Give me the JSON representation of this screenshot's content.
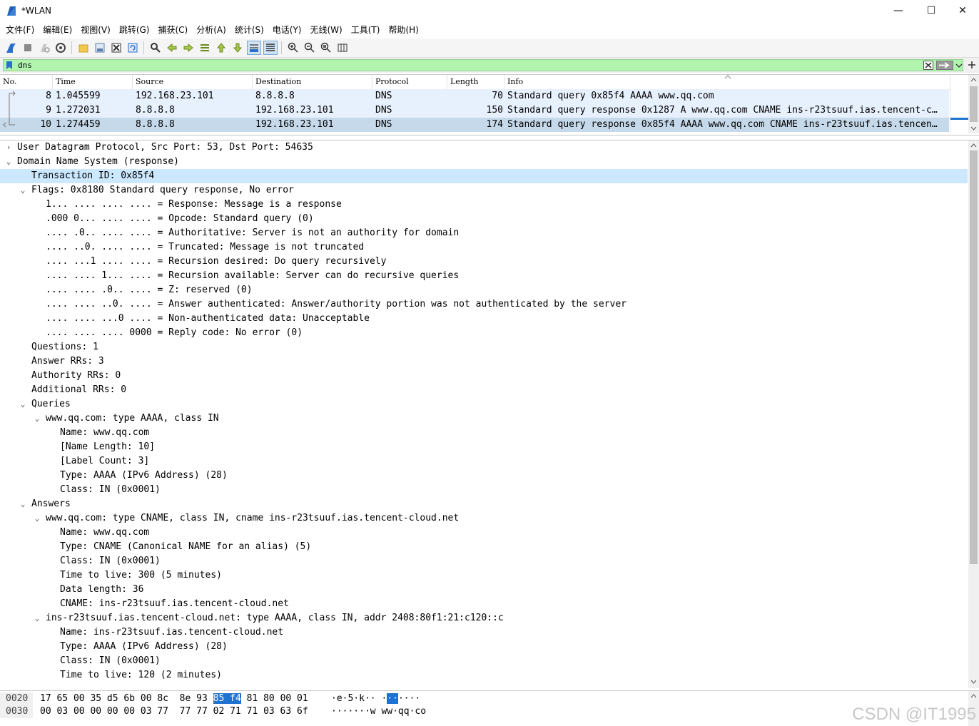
{
  "window": {
    "title": "*WLAN",
    "controls": {
      "minimize": "—",
      "maximize": "☐",
      "close": "✕"
    }
  },
  "menu": [
    "文件(F)",
    "编辑(E)",
    "视图(V)",
    "跳转(G)",
    "捕获(C)",
    "分析(A)",
    "统计(S)",
    "电话(Y)",
    "无线(W)",
    "工具(T)",
    "帮助(H)"
  ],
  "toolbar": {
    "icons": [
      "shark-fin-start-icon",
      "stop-square-icon",
      "restart-icon",
      "options-gear-icon",
      "open-folder-icon",
      "save-file-icon",
      "close-file-icon",
      "reload-icon",
      "find-magnifier-icon",
      "back-arrow-icon",
      "forward-arrow-icon",
      "go-to-packet-icon",
      "first-packet-icon",
      "last-packet-icon",
      "autoscroll-icon",
      "colorize-icon",
      "zoom-in-icon",
      "zoom-out-icon",
      "zoom-normal-icon",
      "resize-columns-icon"
    ]
  },
  "filter": {
    "value": "dns",
    "accent": "#b0f4b0"
  },
  "packet_list": {
    "columns": [
      "No.",
      "Time",
      "Source",
      "Destination",
      "Protocol",
      "Length",
      "Info"
    ],
    "rows": [
      {
        "no": "8",
        "time": "1.045599",
        "source": "192.168.23.101",
        "destination": "8.8.8.8",
        "protocol": "DNS",
        "length": "70",
        "info": "Standard query 0x85f4 AAAA www.qq.com"
      },
      {
        "no": "9",
        "time": "1.272031",
        "source": "8.8.8.8",
        "destination": "192.168.23.101",
        "protocol": "DNS",
        "length": "150",
        "info": "Standard query response 0x1287 A www.qq.com CNAME ins-r23tsuuf.ias.tencent-c…"
      },
      {
        "no": "10",
        "time": "1.274459",
        "source": "8.8.8.8",
        "destination": "192.168.23.101",
        "protocol": "DNS",
        "length": "174",
        "info": "Standard query response 0x85f4 AAAA www.qq.com CNAME ins-r23tsuuf.ias.tencen…"
      }
    ]
  },
  "details": [
    {
      "text": "User Datagram Protocol, Src Port: 53, Dst Port: 54635",
      "exp": "›"
    },
    {
      "text": "Domain Name System (response)",
      "exp": "⌄"
    },
    {
      "text": "Transaction ID: 0x85f4",
      "exp": ""
    },
    {
      "text": "Flags: 0x8180 Standard query response, No error",
      "exp": "⌄"
    },
    {
      "text": "1... .... .... .... = Response: Message is a response",
      "exp": ""
    },
    {
      "text": ".000 0... .... .... = Opcode: Standard query (0)",
      "exp": ""
    },
    {
      "text": ".... .0.. .... .... = Authoritative: Server is not an authority for domain",
      "exp": ""
    },
    {
      "text": ".... ..0. .... .... = Truncated: Message is not truncated",
      "exp": ""
    },
    {
      "text": ".... ...1 .... .... = Recursion desired: Do query recursively",
      "exp": ""
    },
    {
      "text": ".... .... 1... .... = Recursion available: Server can do recursive queries",
      "exp": ""
    },
    {
      "text": ".... .... .0.. .... = Z: reserved (0)",
      "exp": ""
    },
    {
      "text": ".... .... ..0. .... = Answer authenticated: Answer/authority portion was not authenticated by the server",
      "exp": ""
    },
    {
      "text": ".... .... ...0 .... = Non-authenticated data: Unacceptable",
      "exp": ""
    },
    {
      "text": ".... .... .... 0000 = Reply code: No error (0)",
      "exp": ""
    },
    {
      "text": "Questions: 1",
      "exp": ""
    },
    {
      "text": "Answer RRs: 3",
      "exp": ""
    },
    {
      "text": "Authority RRs: 0",
      "exp": ""
    },
    {
      "text": "Additional RRs: 0",
      "exp": ""
    },
    {
      "text": "Queries",
      "exp": "⌄"
    },
    {
      "text": "www.qq.com: type AAAA, class IN",
      "exp": "⌄"
    },
    {
      "text": "Name: www.qq.com",
      "exp": ""
    },
    {
      "text": "[Name Length: 10]",
      "exp": ""
    },
    {
      "text": "[Label Count: 3]",
      "exp": ""
    },
    {
      "text": "Type: AAAA (IPv6 Address) (28)",
      "exp": ""
    },
    {
      "text": "Class: IN (0x0001)",
      "exp": ""
    },
    {
      "text": "Answers",
      "exp": "⌄"
    },
    {
      "text": "www.qq.com: type CNAME, class IN, cname ins-r23tsuuf.ias.tencent-cloud.net",
      "exp": "⌄"
    },
    {
      "text": "Name: www.qq.com",
      "exp": ""
    },
    {
      "text": "Type: CNAME (Canonical NAME for an alias) (5)",
      "exp": ""
    },
    {
      "text": "Class: IN (0x0001)",
      "exp": ""
    },
    {
      "text": "Time to live: 300 (5 minutes)",
      "exp": ""
    },
    {
      "text": "Data length: 36",
      "exp": ""
    },
    {
      "text": "CNAME: ins-r23tsuuf.ias.tencent-cloud.net",
      "exp": ""
    },
    {
      "text": "ins-r23tsuuf.ias.tencent-cloud.net: type AAAA, class IN, addr 2408:80f1:21:c120::c",
      "exp": "⌄"
    },
    {
      "text": "Name: ins-r23tsuuf.ias.tencent-cloud.net",
      "exp": ""
    },
    {
      "text": "Type: AAAA (IPv6 Address) (28)",
      "exp": ""
    },
    {
      "text": "Class: IN (0x0001)",
      "exp": ""
    },
    {
      "text": "Time to live: 120 (2 minutes)",
      "exp": ""
    }
  ],
  "bytes": {
    "rows": [
      {
        "offset": "0020",
        "hex_a": "17 65 00 35 d5 6b 00 8c  8e 93 ",
        "hex_sel": "85 f4",
        "hex_b": " 81 80 00 01",
        "ascii_a": "·e·5·k·· ·",
        "ascii_sel": "··",
        "ascii_b": "····"
      },
      {
        "offset": "0030",
        "hex_a": "00 03 00 00 00 00 03 77  77 77 02 71 71 03 63 6f",
        "hex_sel": "",
        "hex_b": "",
        "ascii_a": "·······w ww·qq·co",
        "ascii_sel": "",
        "ascii_b": ""
      }
    ]
  },
  "watermark": "CSDN @IT1995",
  "colors": {
    "row_bg": "#e7f0fd",
    "row_selected": "#c5d9ea",
    "detail_highlight": "#cce8ff",
    "byte_highlight": "#1e72d0"
  }
}
